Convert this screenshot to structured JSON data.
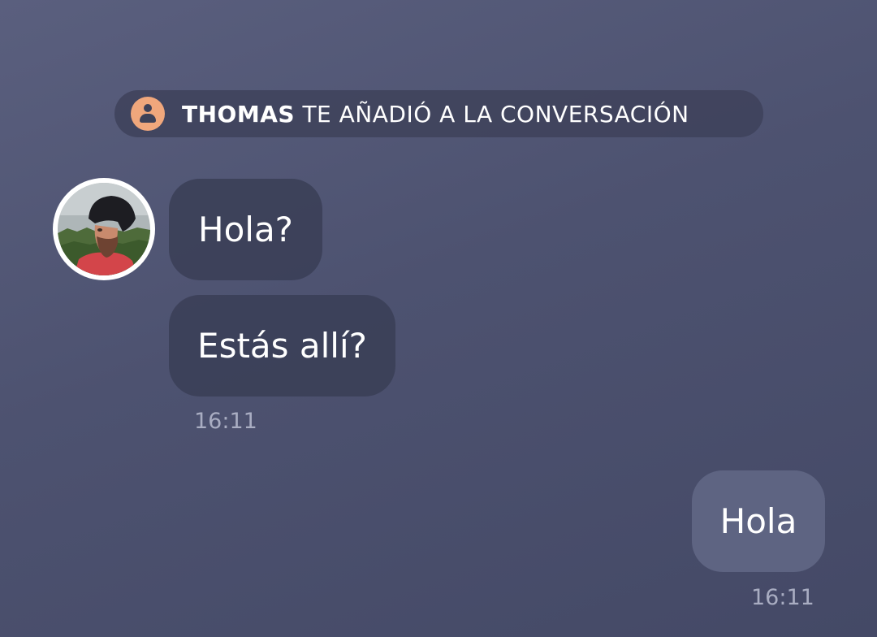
{
  "system_message": {
    "actor": "THOMAS",
    "text": " TE AÑADIÓ A LA CONVERSACIÓN",
    "icon": "user-icon",
    "icon_color": "#f0a77c"
  },
  "incoming": {
    "avatar": "contact-avatar",
    "messages": [
      {
        "text": "Hola?"
      },
      {
        "text": "Estás allí?"
      }
    ],
    "timestamp": "16:11"
  },
  "outgoing": {
    "messages": [
      {
        "text": "Hola"
      }
    ],
    "timestamp": "16:11"
  }
}
